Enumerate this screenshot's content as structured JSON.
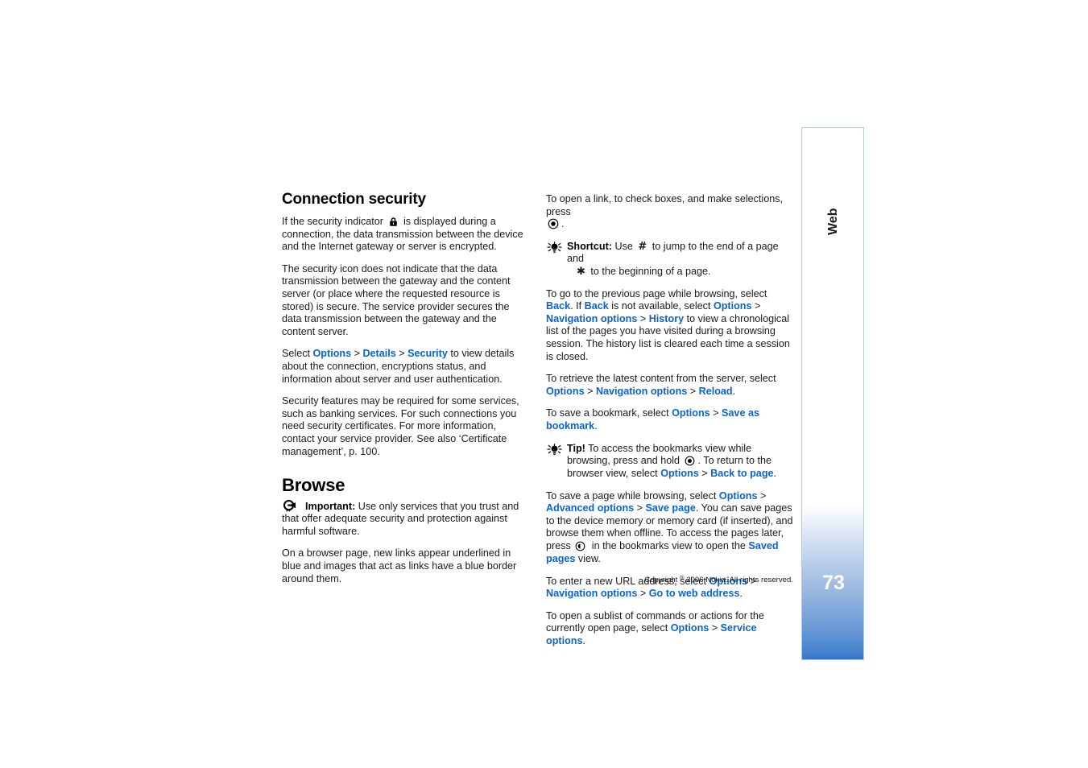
{
  "document": {
    "page_number": "73",
    "tab_label": "Web",
    "copyright_prefix": "Copyright ",
    "copyright_symbol": "®",
    "copyright_suffix": " 2006 Nokia. All rights reserved."
  },
  "left_column": {
    "heading_1": "Connection security",
    "p1_a": "If the security indicator",
    "p1_b": "is displayed during a connection, the data transmission between the device and the Internet gateway or server is encrypted.",
    "p2": "The security icon does not indicate that the data transmission between the gateway and the content server (or place where the requested resource is stored) is secure. The service provider secures the data transmission between the gateway and the content server.",
    "p3_select": "Select ",
    "p3_options": "Options",
    "p3_gt1": " > ",
    "p3_details": "Details",
    "p3_gt2": " > ",
    "p3_security": "Security",
    "p3_tail": " to view details about the connection, encryptions status, and information about server and user authentication.",
    "p4": "Security features may be required for some services, such as banking services. For such connections you need security certificates. For more information, contact your service provider. See also ‘Certificate management’, p. 100.",
    "heading_2": "Browse",
    "important_label": "Important:",
    "important_text": " Use only services that you trust and that offer adequate security and protection against harmful software.",
    "p5": "On a browser page, new links appear underlined in blue and images that act as links have a blue border around them."
  },
  "right_column": {
    "p1_a": "To open a link, to check boxes, and make selections, press",
    "p1_b": ".",
    "shortcut_label": "Shortcut:",
    "shortcut_use": " Use ",
    "shortcut_hash": "#",
    "shortcut_mid": " to jump to the end of a page and",
    "shortcut_star": "✱",
    "shortcut_tail": " to the beginning of a page.",
    "p2_a": "To go to the previous page while browsing, select ",
    "p2_back1": "Back",
    "p2_b": ". If ",
    "p2_back2": "Back",
    "p2_c": " is not available, select ",
    "p2_options": "Options",
    "p2_gt1": " > ",
    "p2_nav": "Navigation options",
    "p2_gt2": " > ",
    "p2_history": "History",
    "p2_tail": " to view a chronological list of the pages you have visited during a browsing session. The history list is cleared each time a session is closed.",
    "p3_a": "To retrieve the latest content from the server, select ",
    "p3_options": "Options",
    "p3_gt1": " > ",
    "p3_nav": "Navigation options",
    "p3_gt2": " > ",
    "p3_reload": "Reload",
    "p3_tail": ".",
    "p4_a": "To save a bookmark, select ",
    "p4_options": "Options",
    "p4_gt1": " > ",
    "p4_save": "Save as bookmark",
    "p4_tail": ".",
    "tip_label": "Tip!",
    "tip_a": " To access the bookmarks view while browsing, press and hold ",
    "tip_b": ". To return to the browser view, select ",
    "tip_options": "Options",
    "tip_gt": " > ",
    "tip_back": "Back to page",
    "tip_tail": ".",
    "p5_a": "To save a page while browsing, select ",
    "p5_options": "Options",
    "p5_gt1": " > ",
    "p5_adv": "Advanced options",
    "p5_gt2": " > ",
    "p5_savepage": "Save page",
    "p5_b": ". You can save pages to the device memory or memory card (if inserted), and browse them when offline. To access the pages later, press ",
    "p5_c": " in the bookmarks view to open the ",
    "p5_saved": "Saved pages",
    "p5_tail": " view.",
    "p6_a": "To enter a new URL address, select ",
    "p6_options": "Options",
    "p6_gt1": " > ",
    "p6_nav": "Navigation options",
    "p6_gt2": " > ",
    "p6_goto": "Go to web address",
    "p6_tail": ".",
    "p7_a": "To open a sublist of commands or actions for the currently open page, select ",
    "p7_options": "Options",
    "p7_gt1": " > ",
    "p7_service": "Service options",
    "p7_tail": "."
  },
  "colors": {
    "link_blue": "#0a63d2",
    "tab_blue": "#2a72c4",
    "tab_border": "#b8cbe4",
    "text": "#1a1a1a"
  }
}
